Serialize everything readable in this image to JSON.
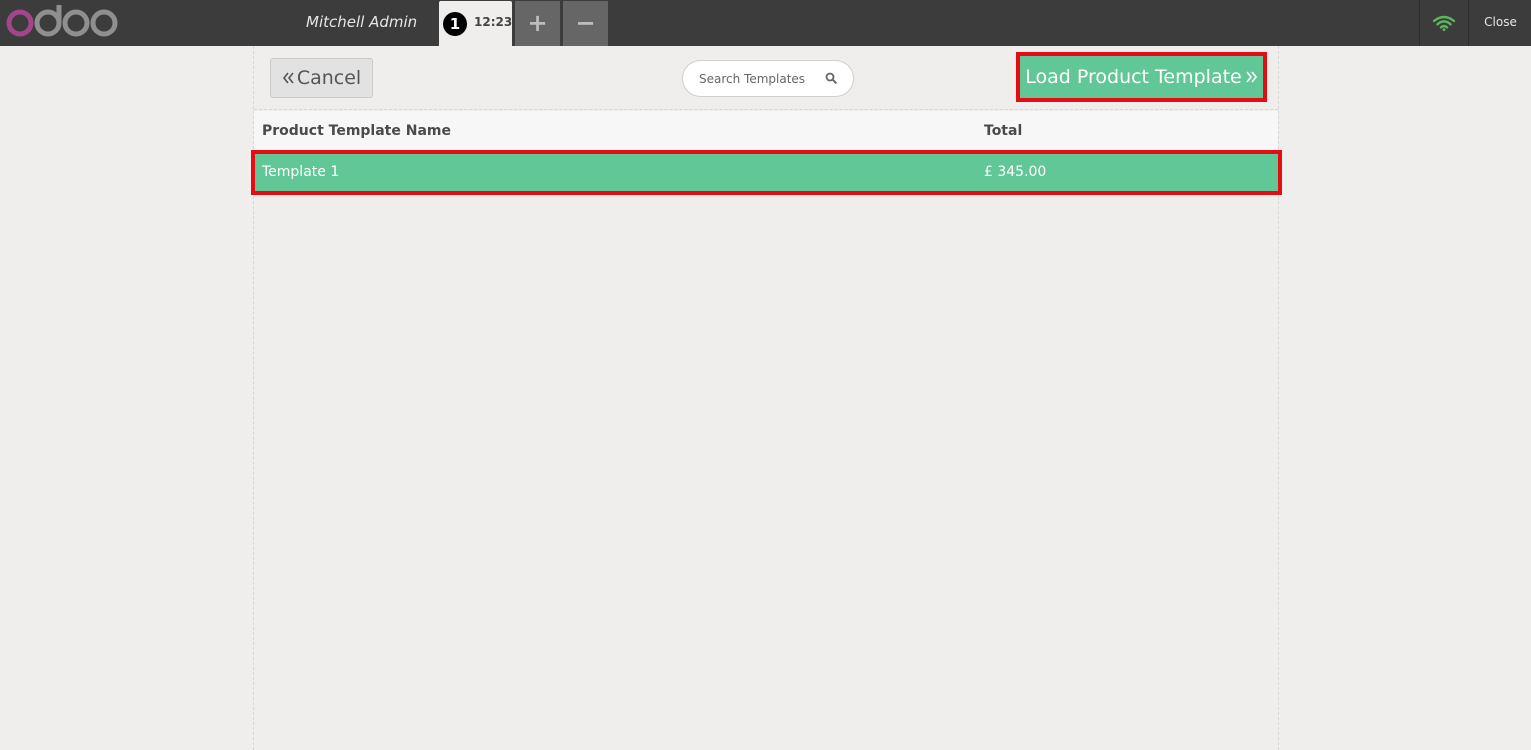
{
  "header": {
    "logo_text": "odoo",
    "cashier_name": "Mitchell Admin",
    "order_tab": {
      "sequence": "1",
      "time": "12:23"
    },
    "add_order_symbol": "+",
    "remove_order_symbol": "−",
    "close_label": "Close",
    "status_icon": "wifi-icon",
    "status_color": "#5cb85c"
  },
  "screen": {
    "cancel_label": "Cancel",
    "cancel_icon": "double-chevron-left-icon",
    "search_placeholder": "Search Templates",
    "search_icon": "search-icon",
    "load_label": "Load Product Template",
    "load_icon": "double-chevron-right-icon"
  },
  "table": {
    "columns": [
      "Product Template Name",
      "Total"
    ],
    "rows": [
      {
        "name": "Template 1",
        "total": "£ 345.00"
      }
    ]
  },
  "colors": {
    "accent": "#62c797",
    "highlight_border": "#e30d13",
    "topbar": "#3c3c3c",
    "background": "#efeeec"
  }
}
